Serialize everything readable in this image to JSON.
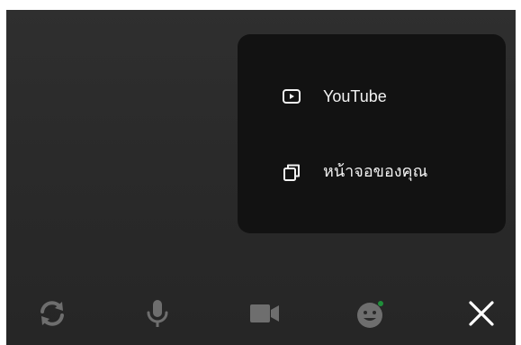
{
  "menu": {
    "items": [
      {
        "label": "YouTube",
        "icon": "youtube-play-icon"
      },
      {
        "label": "หน้าจอของคุณ",
        "icon": "screen-copy-icon"
      }
    ]
  },
  "controls": [
    {
      "name": "switch-camera",
      "icon": "switch-camera-icon"
    },
    {
      "name": "microphone",
      "icon": "microphone-icon"
    },
    {
      "name": "video-camera",
      "icon": "video-camera-icon"
    },
    {
      "name": "effects",
      "icon": "effects-face-icon"
    },
    {
      "name": "close",
      "icon": "close-icon"
    }
  ],
  "colors": {
    "background": "#2a2a2a",
    "menu_background": "#121212",
    "menu_text": "#f2f2f2",
    "control_inactive": "#6e6e6e",
    "close_color": "#ffffff",
    "effects_dot": "#1f8f3a"
  }
}
